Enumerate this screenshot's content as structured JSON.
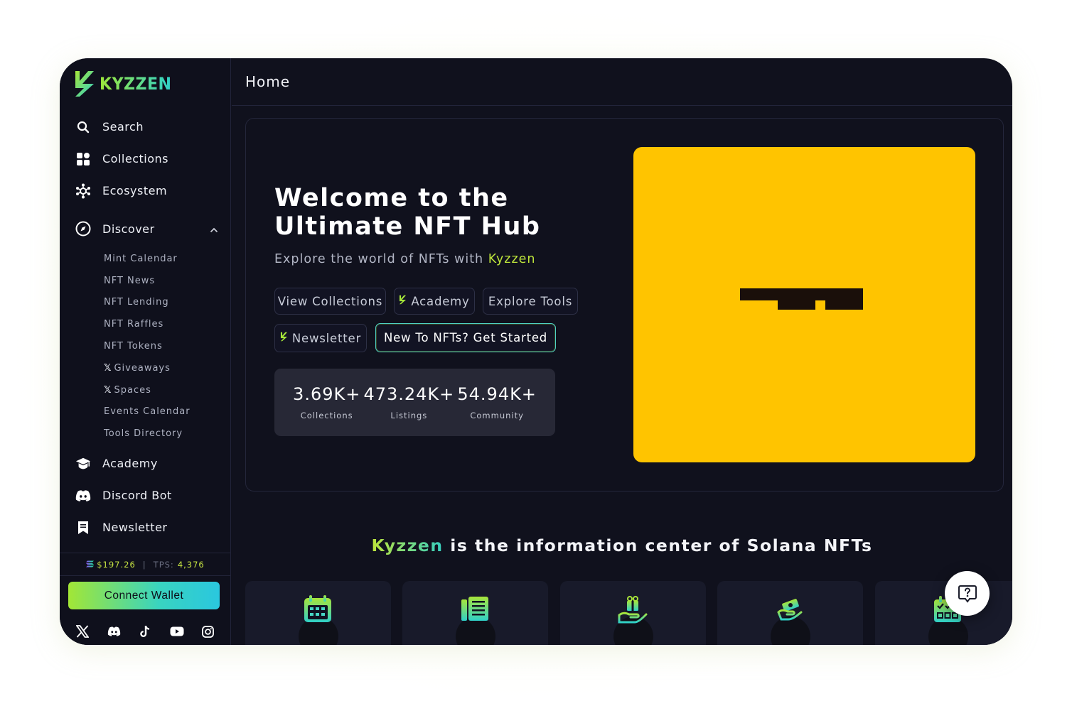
{
  "brand": {
    "logo_text": "KYZZEN"
  },
  "topbar": {
    "title": "Home"
  },
  "sidebar": {
    "items": [
      {
        "label": "Search",
        "icon": "search-icon"
      },
      {
        "label": "Collections",
        "icon": "grid-icon"
      },
      {
        "label": "Ecosystem",
        "icon": "network-icon"
      }
    ],
    "discover": {
      "label": "Discover",
      "icon": "compass-icon",
      "expanded": true,
      "subitems": [
        {
          "label": "Mint Calendar"
        },
        {
          "label": "NFT News"
        },
        {
          "label": "NFT Lending"
        },
        {
          "label": "NFT Raffles"
        },
        {
          "label": "NFT Tokens"
        },
        {
          "label": "Giveaways",
          "prefix": "𝕏"
        },
        {
          "label": "Spaces",
          "prefix": "𝕏"
        },
        {
          "label": "Events Calendar"
        },
        {
          "label": "Tools Directory"
        }
      ]
    },
    "bottom_items": [
      {
        "label": "Academy",
        "icon": "graduation-cap-icon"
      },
      {
        "label": "Discord Bot",
        "icon": "discord-icon"
      },
      {
        "label": "Newsletter",
        "icon": "newsletter-icon"
      }
    ],
    "price": {
      "sol_price": "$197.26",
      "tps_label": "TPS:",
      "tps_value": "4,376",
      "separator": "|"
    },
    "connect_wallet": "Connect Wallet",
    "socials": [
      "x-icon",
      "discord-icon",
      "tiktok-icon",
      "youtube-icon",
      "instagram-icon"
    ]
  },
  "hero": {
    "title_line1": "Welcome to the",
    "title_line2": "Ultimate NFT Hub",
    "subtitle_prefix": "Explore the world of NFTs with ",
    "subtitle_brand": "Kyzzen",
    "buttons": {
      "view_collections": "View Collections",
      "academy": "Academy",
      "explore_tools": "Explore Tools",
      "newsletter": "Newsletter",
      "get_started": "New To NFTs? Get Started"
    },
    "stats": [
      {
        "value": "3.69K+",
        "label": "Collections"
      },
      {
        "value": "473.24K+",
        "label": "Listings"
      },
      {
        "value": "54.94K+",
        "label": "Community"
      }
    ],
    "image_bg": "#ffc400"
  },
  "tagline": {
    "brand": "Kyzzen",
    "rest": " is the information center of Solana NFTs"
  },
  "feature_cards": [
    {
      "icon": "calendar-icon"
    },
    {
      "icon": "news-icon"
    },
    {
      "icon": "gift-hand-icon"
    },
    {
      "icon": "lending-icon"
    },
    {
      "icon": "events-calendar-icon"
    }
  ],
  "colors": {
    "accent_green": "#bde43b",
    "accent_teal": "#35cfc1",
    "background": "#10111d",
    "hero_image": "#ffc400"
  }
}
